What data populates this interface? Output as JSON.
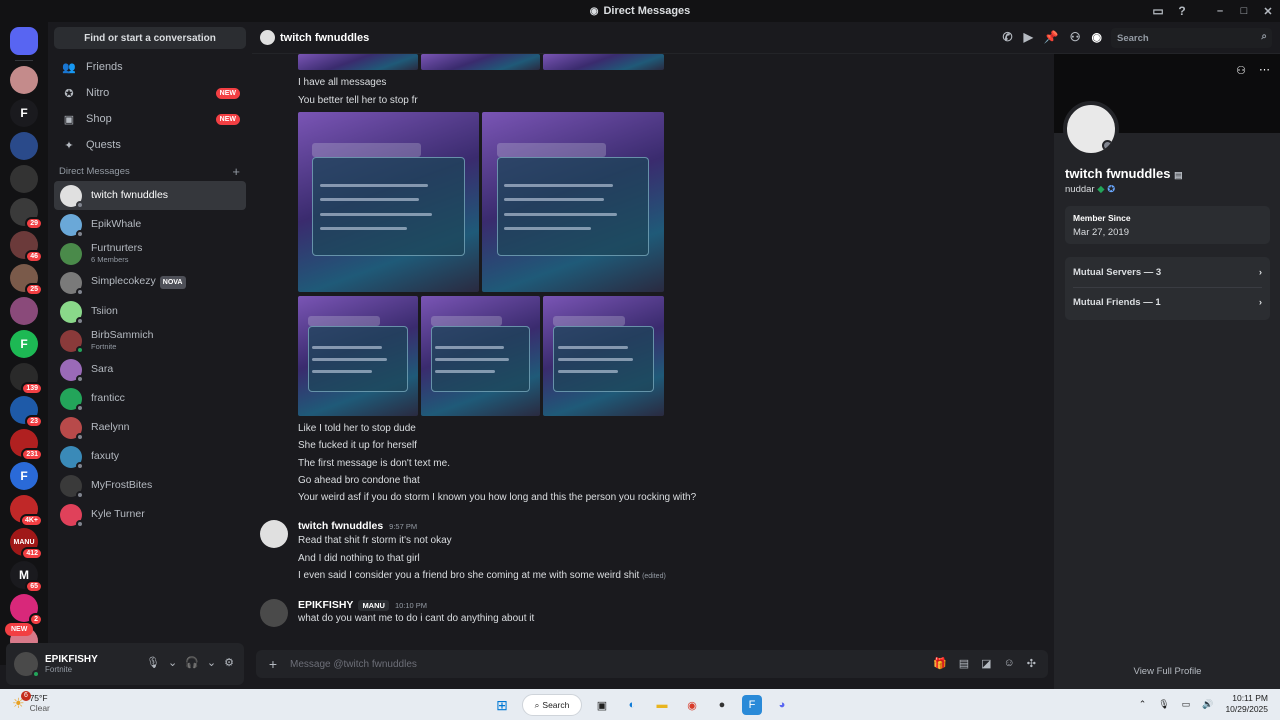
{
  "window": {
    "title": "Direct Messages"
  },
  "servers": {
    "icons": [
      {
        "label": "",
        "color": "#5865f2",
        "badge": ""
      },
      {
        "label": "",
        "color": "#c48b8b",
        "badge": ""
      },
      {
        "label": "F",
        "color": "#1a1a1e",
        "badge": ""
      },
      {
        "label": "",
        "color": "#2a4a8a",
        "badge": ""
      },
      {
        "label": "",
        "color": "#333",
        "badge": ""
      },
      {
        "label": "",
        "color": "#3a3a3a",
        "badge": "29"
      },
      {
        "label": "",
        "color": "#6b3a3a",
        "badge": "46"
      },
      {
        "label": "",
        "color": "#7a5a4a",
        "badge": "25"
      },
      {
        "label": "",
        "color": "#8a4a7a",
        "badge": ""
      },
      {
        "label": "F",
        "color": "#1db954",
        "badge": ""
      },
      {
        "label": "",
        "color": "#2a2a2a",
        "badge": "139"
      },
      {
        "label": "",
        "color": "#1e5aa8",
        "badge": "23"
      },
      {
        "label": "",
        "color": "#b02020",
        "badge": "231"
      },
      {
        "label": "F",
        "color": "#2a6ad8",
        "badge": ""
      },
      {
        "label": "",
        "color": "#c02828",
        "badge": "4K+"
      },
      {
        "label": "MANU",
        "color": "#a01818",
        "badge": "412"
      },
      {
        "label": "M",
        "color": "#1a1a1e",
        "badge": "65"
      },
      {
        "label": "",
        "color": "#d8287a",
        "badge": "2"
      },
      {
        "label": "",
        "color": "#d87a8a",
        "badge": ""
      }
    ],
    "new_label": "NEW"
  },
  "dm_column": {
    "search_label": "Find or start a conversation",
    "nav": [
      {
        "label": "Friends",
        "icon": "friends-icon",
        "glyph": "👥",
        "badge": ""
      },
      {
        "label": "Nitro",
        "icon": "nitro-icon",
        "glyph": "✪",
        "badge": "NEW"
      },
      {
        "label": "Shop",
        "icon": "shop-icon",
        "glyph": "▣",
        "badge": "NEW"
      },
      {
        "label": "Quests",
        "icon": "quests-icon",
        "glyph": "✦",
        "badge": ""
      }
    ],
    "dm_header": "Direct Messages",
    "dm_add": "+",
    "dms": [
      {
        "name": "twitch fwnuddles",
        "sub": "",
        "tag": "",
        "color": "#e0e0e0",
        "status": "#80848e"
      },
      {
        "name": "EpikWhale",
        "sub": "",
        "tag": "",
        "color": "#6aa8d8",
        "status": "#80848e"
      },
      {
        "name": "Furtnurters",
        "sub": "6 Members",
        "tag": "",
        "color": "#4a8a4a",
        "status": ""
      },
      {
        "name": "Simplecokezy",
        "sub": "",
        "tag": "NOVA",
        "color": "#7a7a7a",
        "status": "#80848e"
      },
      {
        "name": "Tsiion",
        "sub": "",
        "tag": "",
        "color": "#8ad88a",
        "status": "#80848e"
      },
      {
        "name": "BirbSammich",
        "sub": "Fortnite",
        "tag": "",
        "color": "#8a3a3a",
        "status": "#23a55a"
      },
      {
        "name": "Sara",
        "sub": "",
        "tag": "",
        "color": "#9a6ab8",
        "status": "#80848e"
      },
      {
        "name": "franticc",
        "sub": "",
        "tag": "",
        "color": "#23a55a",
        "status": "#80848e"
      },
      {
        "name": "Raelynn",
        "sub": "",
        "tag": "",
        "color": "#b84a4a",
        "status": "#80848e"
      },
      {
        "name": "faxuty",
        "sub": "",
        "tag": "",
        "color": "#3a8ab8",
        "status": "#80848e"
      },
      {
        "name": "MyFrostBites",
        "sub": "",
        "tag": "",
        "color": "#3a3a3a",
        "status": "#80848e"
      },
      {
        "name": "Kyle Turner",
        "sub": "",
        "tag": "",
        "color": "#e0415a",
        "status": "#80848e"
      }
    ]
  },
  "user": {
    "name": "EPIKFISHY",
    "status": "Fortnite"
  },
  "chat": {
    "title": "twitch fwnuddles",
    "search_placeholder": "Search",
    "lines_top": [
      "I have all messages",
      "You better tell her to stop fr"
    ],
    "lines_mid": [
      "Like I told her to stop dude",
      "She fucked it up for herself",
      "The first message is don't text me.",
      "Go ahead bro condone that",
      "Your weird asf if you do storm I known you how long and this the person you rocking with?"
    ],
    "msg2": {
      "author": "twitch fwnuddles",
      "time": "9:57 PM",
      "lines": [
        "Read that shit fr storm it's not okay",
        "And I did nothing to that girl",
        "I even said I consider you a friend bro she coming at me with some weird  shit"
      ],
      "edited": "(edited)"
    },
    "msg3": {
      "author": "EPIKFISHY",
      "role": "MANU",
      "time": "10:10 PM",
      "lines": [
        "what do you want me to do i cant do anything about it"
      ]
    },
    "composer_placeholder": "Message @twitch fwnuddles"
  },
  "profile": {
    "name": "twitch fwnuddles",
    "username": "nuddar",
    "member_since_label": "Member Since",
    "member_since": "Mar 27, 2019",
    "mutual_servers": "Mutual Servers — 3",
    "mutual_friends": "Mutual Friends — 1",
    "view_full": "View Full Profile"
  },
  "taskbar": {
    "temp": "75°F",
    "weather": "Clear",
    "weather_badge": "6",
    "search": "Search",
    "time": "10:11 PM",
    "date": "10/29/2025"
  }
}
